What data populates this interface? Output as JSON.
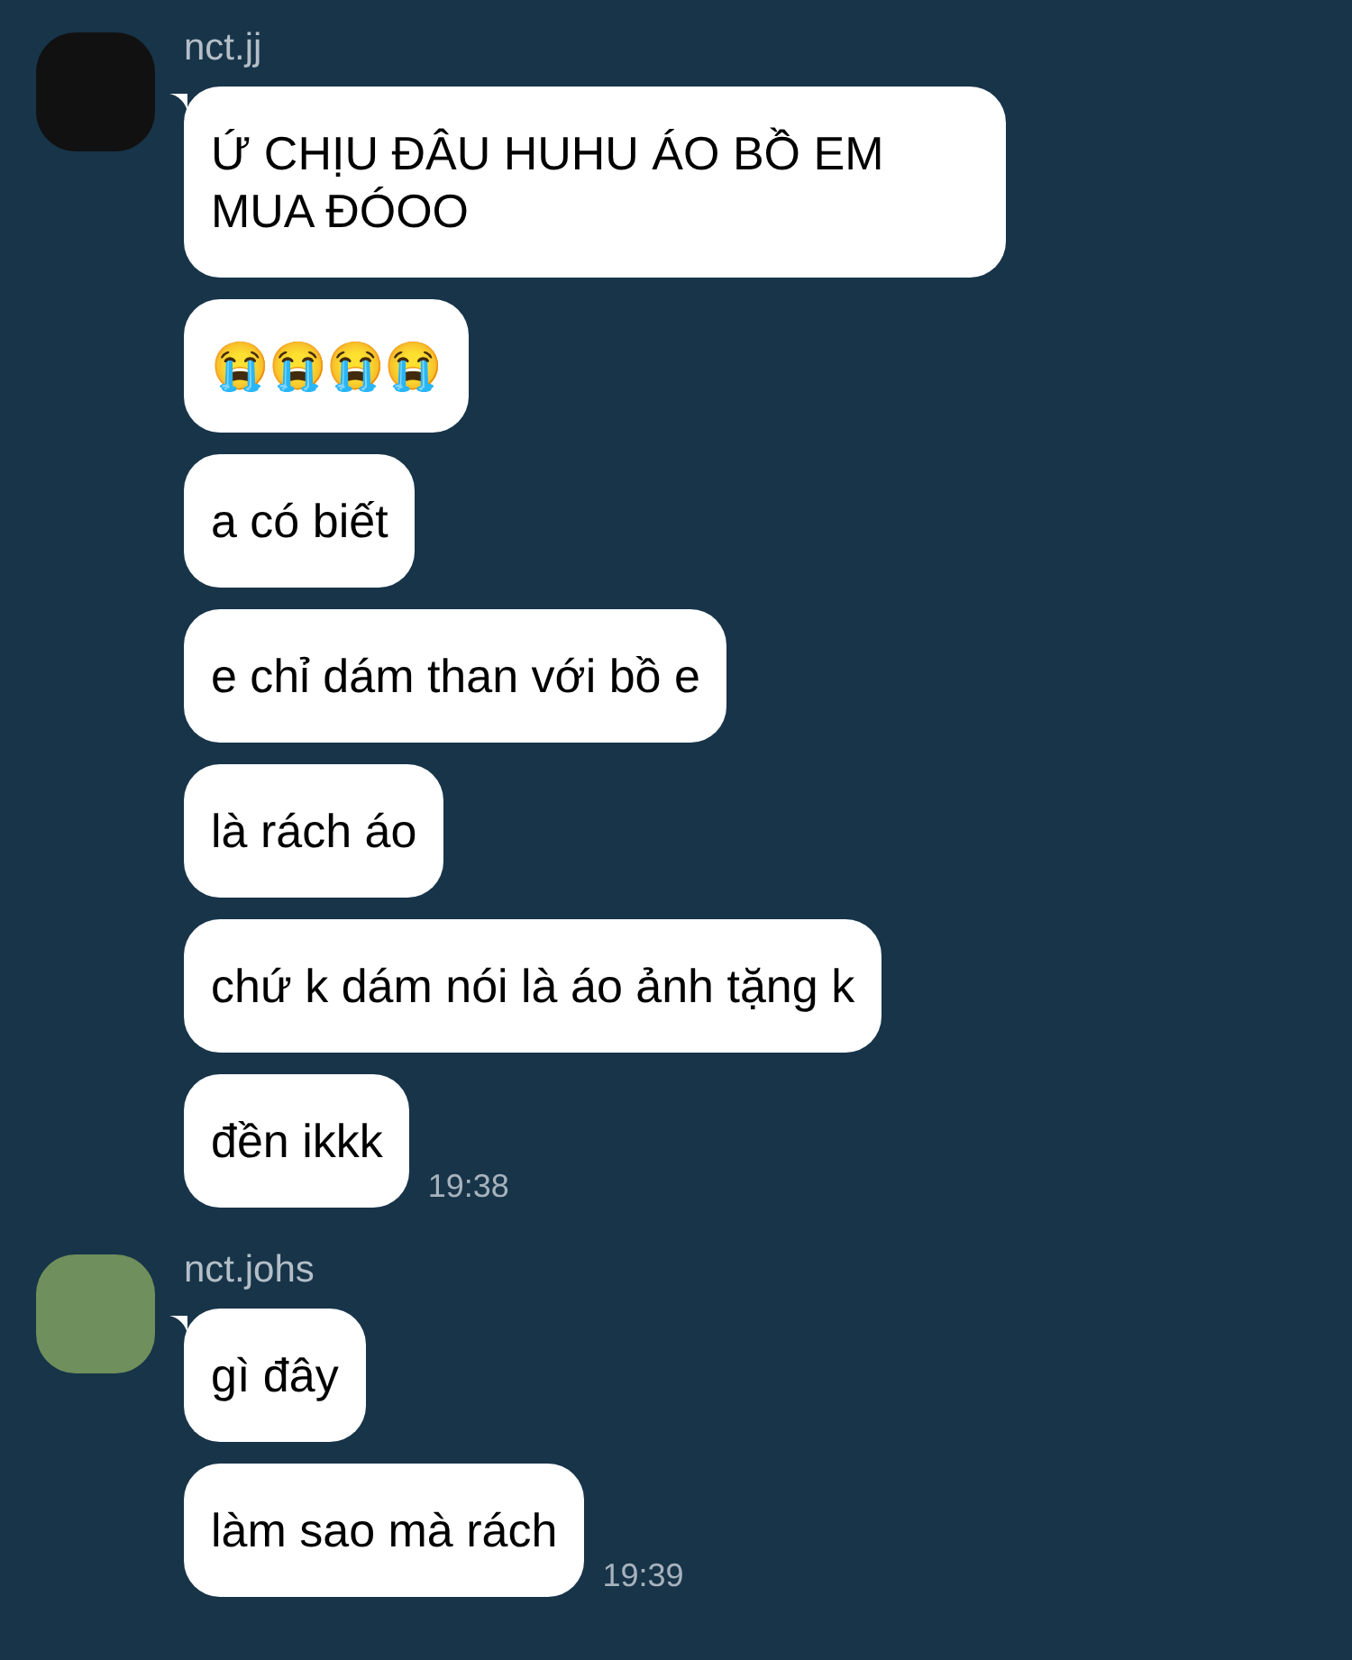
{
  "groups": [
    {
      "sender": "nct.jj",
      "messages": [
        {
          "text": "Ứ CHỊU ĐÂU HUHU ÁO BỒ EM MUA ĐÓOO"
        },
        {
          "text": "😭😭😭😭"
        },
        {
          "text": "a có biết"
        },
        {
          "text": "e chỉ dám than với bồ e"
        },
        {
          "text": "là rách áo"
        },
        {
          "text": "chứ k dám nói là áo ảnh tặng k"
        },
        {
          "text": "đền ikkk",
          "time": "19:38"
        }
      ]
    },
    {
      "sender": "nct.johs",
      "messages": [
        {
          "text": "gì đây"
        },
        {
          "text": "làm sao mà rách",
          "time": "19:39"
        }
      ]
    }
  ]
}
